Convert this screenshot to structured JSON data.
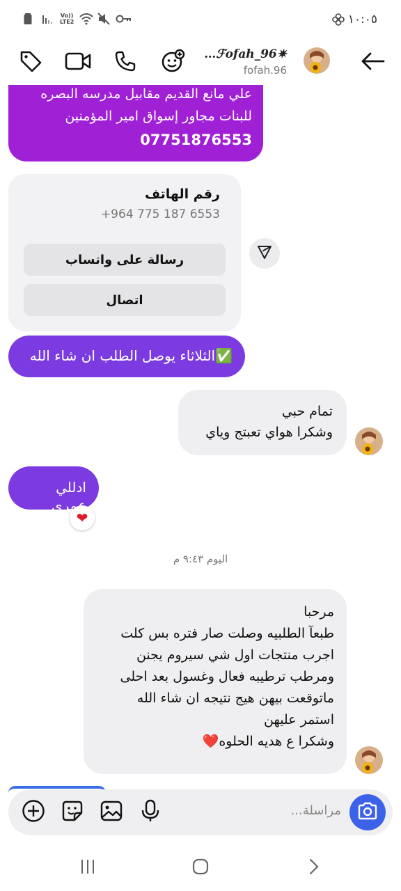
{
  "status_bar": {
    "time": "١٠:٠٥",
    "network_label_top": "Vo))",
    "network_label_bottom": "LTE2",
    "icons": [
      "battery-icon",
      "signal-icon",
      "wifi-icon",
      "mute-icon",
      "key-icon",
      "settings-flower-icon"
    ]
  },
  "header": {
    "display_name": "…ℱofah_96✷",
    "username": "fofah.96",
    "icons": [
      "back-arrow-icon",
      "tag-icon",
      "video-call-icon",
      "phone-call-icon",
      "add-emoji-icon"
    ]
  },
  "messages": {
    "address": {
      "line1": "علي مانع القديم مقابيل مدرسه البصره",
      "line2": "للبنات مجاور إسواق امير المؤمنين",
      "phone": "07751876553"
    },
    "contact_card": {
      "title": "رقم الهاتف",
      "number": "+964 775 187 6553",
      "whatsapp_label": "رسالة على واتساب",
      "call_label": "اتصال"
    },
    "delivery": "✅الثلاثاء يوصل الطلب ان شاء الله",
    "reply1": {
      "line1": "تمام حبي",
      "line2": "وشكرا هواي تعبتج وياي"
    },
    "reply2": "ادللي عمري",
    "reaction": "❤",
    "timestamp": "اليوم ٩:٤٣ م",
    "long_message": {
      "l1": "مرحبا",
      "l2": "طبعآ الطلبيه وصلت صار فتره بس كلت",
      "l3": "اجرب منتجات اول شي سيروم يجنن",
      "l4": "ومرطب ترطيبه فعال وغسول بعد احلى",
      "l5": "ماتوقعت بيهن هيج نتيجه ان شاء الله",
      "l6": "استمر عليهن",
      "l7": "وشكرا ع هديه الحلوه❤️"
    }
  },
  "composer": {
    "placeholder": "مراسلة...",
    "icons": [
      "add-icon",
      "sticker-icon",
      "gallery-icon",
      "microphone-icon",
      "camera-icon"
    ]
  },
  "navbar": {
    "icons": [
      "recent-apps-icon",
      "home-icon",
      "back-icon"
    ]
  },
  "colors": {
    "bubble_magenta": "#a020d6",
    "bubble_violet": "#7b3be0",
    "bubble_grey": "#efeff1",
    "camera_blue": "#3c62e8",
    "heart_red": "#e0192b"
  }
}
